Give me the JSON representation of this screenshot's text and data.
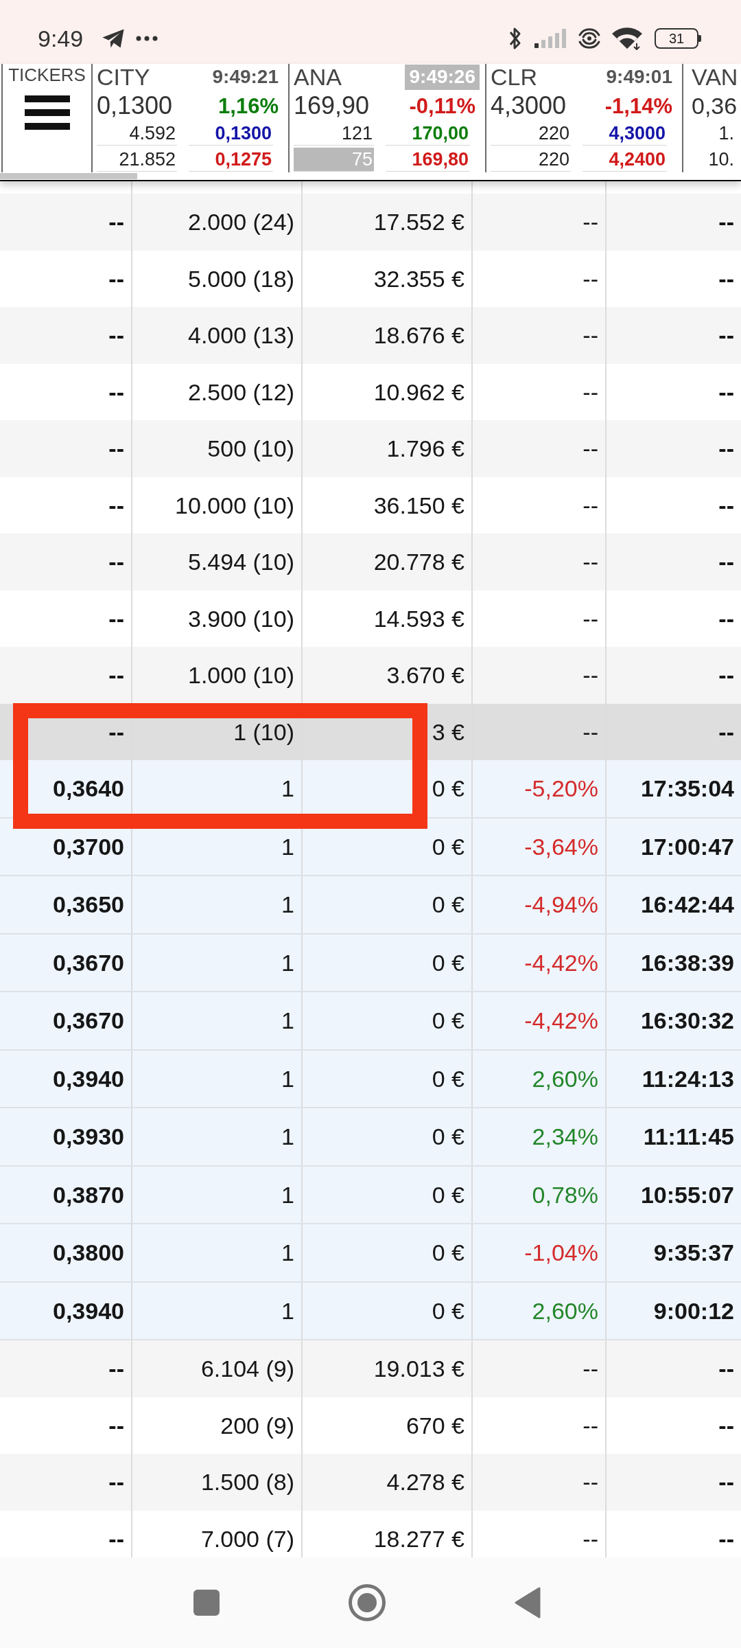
{
  "status_bar": {
    "time": "9:49",
    "battery": "31"
  },
  "ticker_bar": {
    "label": "TICKERS",
    "tickers": [
      {
        "kind": "full",
        "symbol": "CITY",
        "time": "9:49:21",
        "time_highlighted": false,
        "price": "0,1300",
        "change": {
          "text": "1,16%",
          "color": "#0b7d0b"
        },
        "volume_1": "4.592",
        "bid": {
          "text": "0,1300",
          "color": "#1414a8"
        },
        "volume_2": "21.852",
        "volume_2_highlighted": false,
        "ask": {
          "text": "0,1275",
          "color": "#d11a1a"
        }
      },
      {
        "kind": "full",
        "symbol": "ANA",
        "time": "9:49:26",
        "time_highlighted": true,
        "price": "169,90",
        "change": {
          "text": "-0,11%",
          "color": "#d11a1a"
        },
        "volume_1": "121",
        "bid": {
          "text": "170,00",
          "color": "#0b7d0b"
        },
        "volume_2": "75",
        "volume_2_highlighted": true,
        "ask": {
          "text": "169,80",
          "color": "#d11a1a"
        }
      },
      {
        "kind": "full",
        "symbol": "CLR",
        "time": "9:49:01",
        "time_highlighted": false,
        "price": "4,3000",
        "change": {
          "text": "-1,14%",
          "color": "#d11a1a"
        },
        "volume_1": "220",
        "bid": {
          "text": "4,3000",
          "color": "#1414a8"
        },
        "volume_2": "220",
        "volume_2_highlighted": false,
        "ask": {
          "text": "4,2400",
          "color": "#d11a1a"
        }
      },
      {
        "kind": "partial",
        "symbol": "VAN",
        "price": "0,36",
        "volume_1": "1.",
        "volume_2": "10."
      }
    ]
  },
  "table": {
    "rows": [
      {
        "cells": [
          "--",
          "2.000 (24)",
          "17.552 €",
          "--",
          "--"
        ],
        "expanded": false
      },
      {
        "cells": [
          "--",
          "5.000 (18)",
          "32.355 €",
          "--",
          "--"
        ],
        "expanded": false
      },
      {
        "cells": [
          "--",
          "4.000 (13)",
          "18.676 €",
          "--",
          "--"
        ],
        "expanded": false
      },
      {
        "cells": [
          "--",
          "2.500 (12)",
          "10.962 €",
          "--",
          "--"
        ],
        "expanded": false
      },
      {
        "cells": [
          "--",
          "500 (10)",
          "1.796 €",
          "--",
          "--"
        ],
        "expanded": false
      },
      {
        "cells": [
          "--",
          "10.000 (10)",
          "36.150 €",
          "--",
          "--"
        ],
        "expanded": false
      },
      {
        "cells": [
          "--",
          "5.494 (10)",
          "20.778 €",
          "--",
          "--"
        ],
        "expanded": false
      },
      {
        "cells": [
          "--",
          "3.900 (10)",
          "14.593 €",
          "--",
          "--"
        ],
        "expanded": false
      },
      {
        "cells": [
          "--",
          "1.000 (10)",
          "3.670 €",
          "--",
          "--"
        ],
        "expanded": false
      },
      {
        "cells": [
          "--",
          "1 (10)",
          "3 €",
          "--",
          "--"
        ],
        "expanded": true,
        "children": [
          {
            "cells": [
              "0,3640",
              "1",
              "0 €",
              "-5,20%",
              "17:35:04"
            ],
            "color": "#d42a2a"
          },
          {
            "cells": [
              "0,3700",
              "1",
              "0 €",
              "-3,64%",
              "17:00:47"
            ],
            "color": "#d42a2a"
          },
          {
            "cells": [
              "0,3650",
              "1",
              "0 €",
              "-4,94%",
              "16:42:44"
            ],
            "color": "#d42a2a"
          },
          {
            "cells": [
              "0,3670",
              "1",
              "0 €",
              "-4,42%",
              "16:38:39"
            ],
            "color": "#d42a2a"
          },
          {
            "cells": [
              "0,3670",
              "1",
              "0 €",
              "-4,42%",
              "16:30:32"
            ],
            "color": "#d42a2a"
          },
          {
            "cells": [
              "0,3940",
              "1",
              "0 €",
              "2,60%",
              "11:24:13"
            ],
            "color": "#23862a"
          },
          {
            "cells": [
              "0,3930",
              "1",
              "0 €",
              "2,34%",
              "11:11:45"
            ],
            "color": "#23862a"
          },
          {
            "cells": [
              "0,3870",
              "1",
              "0 €",
              "0,78%",
              "10:55:07"
            ],
            "color": "#23862a"
          },
          {
            "cells": [
              "0,3800",
              "1",
              "0 €",
              "-1,04%",
              "9:35:37"
            ],
            "color": "#d42a2a"
          },
          {
            "cells": [
              "0,3940",
              "1",
              "0 €",
              "2,60%",
              "9:00:12"
            ],
            "color": "#23862a"
          }
        ]
      },
      {
        "cells": [
          "--",
          "6.104 (9)",
          "19.013 €",
          "--",
          "--"
        ],
        "expanded": false
      },
      {
        "cells": [
          "--",
          "200 (9)",
          "670 €",
          "--",
          "--"
        ],
        "expanded": false
      },
      {
        "cells": [
          "--",
          "1.500 (8)",
          "4.278 €",
          "--",
          "--"
        ],
        "expanded": false
      },
      {
        "cells": [
          "--",
          "7.000 (7)",
          "18.277 €",
          "--",
          "--"
        ],
        "expanded": false
      }
    ]
  }
}
